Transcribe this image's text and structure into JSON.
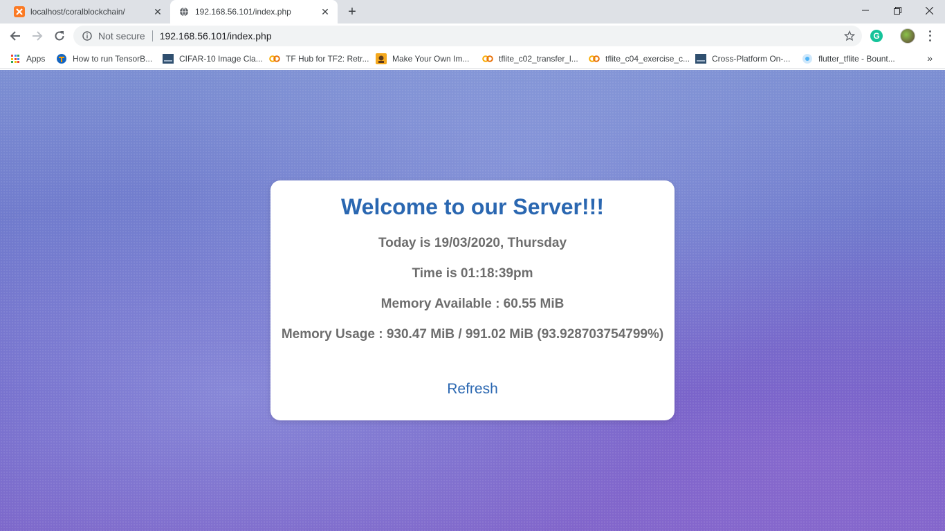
{
  "browser": {
    "tabs": [
      {
        "title": "localhost/coralblockchain/",
        "favicon": "xampp-icon",
        "active": false
      },
      {
        "title": "192.168.56.101/index.php",
        "favicon": "globe-icon",
        "active": true
      }
    ],
    "omnibox": {
      "security_label": "Not secure",
      "url": "192.168.56.101/index.php"
    },
    "bookmarks": [
      {
        "label": "Apps",
        "icon": "apps-grid-icon"
      },
      {
        "label": "How to run TensorB...",
        "icon": "tensorflow-icon"
      },
      {
        "label": "CIFAR-10 Image Cla...",
        "icon": "site-thumbnail-icon"
      },
      {
        "label": "TF Hub for TF2: Retr...",
        "icon": "colab-icon"
      },
      {
        "label": "Make Your Own Im...",
        "icon": "bookmark-site-icon"
      },
      {
        "label": "tflite_c02_transfer_l...",
        "icon": "colab-icon"
      },
      {
        "label": "tflite_c04_exercise_c...",
        "icon": "colab-icon"
      },
      {
        "label": "Cross-Platform On-...",
        "icon": "site-thumbnail-icon"
      },
      {
        "label": "flutter_tflite - Bount...",
        "icon": "bountysource-icon"
      }
    ]
  },
  "page": {
    "title": "Welcome to our Server!!!",
    "date_line": "Today is 19/03/2020, Thursday",
    "time_line": "Time is 01:18:39pm",
    "memory_available": "Memory Available : 60.55 MiB",
    "memory_usage": "Memory Usage : 930.47 MiB / 991.02 MiB (93.928703754799%)",
    "refresh_label": "Refresh"
  },
  "colors": {
    "title_blue": "#2a67b1",
    "text_gray": "#6d6d6d",
    "background_top": "#7c8fd2",
    "background_bottom": "#7a62c8"
  }
}
